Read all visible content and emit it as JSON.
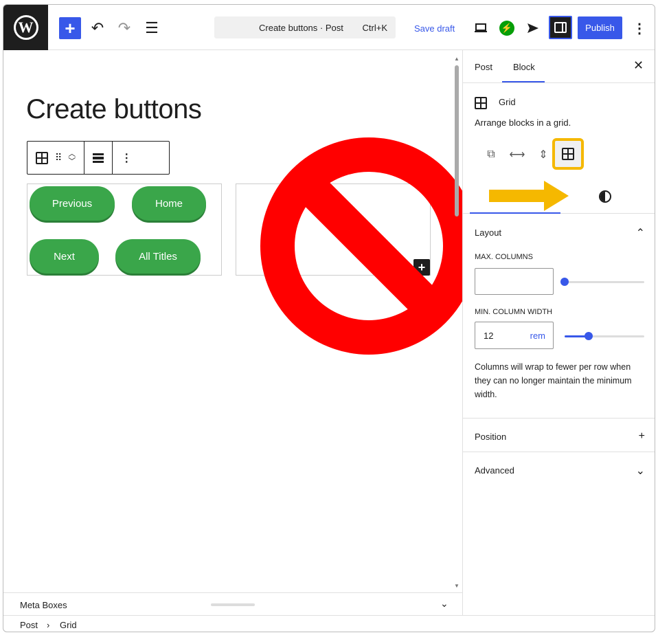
{
  "topbar": {
    "logo": "wordpress-logo",
    "inserter_label": "+",
    "command_title": "Create buttons · Post",
    "command_shortcut": "Ctrl+K",
    "save_draft": "Save draft",
    "publish": "Publish",
    "icons": [
      "undo-icon",
      "redo-icon",
      "list-view-icon",
      "preview-icon",
      "jetpack-icon",
      "send-icon",
      "settings-icon",
      "options-icon"
    ]
  },
  "editor": {
    "post_title": "Create buttons",
    "buttons": [
      "Previous",
      "Home",
      "Next",
      "All Titles"
    ]
  },
  "meta_boxes": {
    "label": "Meta Boxes"
  },
  "breadcrumb": {
    "root": "Post",
    "separator": "›",
    "current": "Grid"
  },
  "sidebar": {
    "tabs": [
      "Post",
      "Block"
    ],
    "active_tab": "Block",
    "block_name": "Grid",
    "block_description": "Arrange blocks in a grid.",
    "variations": [
      "Group",
      "Row",
      "Stack",
      "Grid"
    ],
    "active_variation": "Grid",
    "layout": {
      "title": "Layout",
      "max_columns_label": "Max. Columns",
      "max_columns_value": "",
      "max_columns_slider": 0,
      "min_col_width_label": "Min. Column Width",
      "min_col_width_value": "12",
      "min_col_width_unit": "rem",
      "min_col_width_slider": 0.3,
      "help_text": "Columns will wrap to fewer per row when they can no longer maintain the minimum width."
    },
    "position_title": "Position",
    "advanced_title": "Advanced"
  },
  "colors": {
    "accent": "#3858e9",
    "button_green": "#3aa64a",
    "highlight": "#f5b800",
    "no_sign": "#ff0000"
  }
}
